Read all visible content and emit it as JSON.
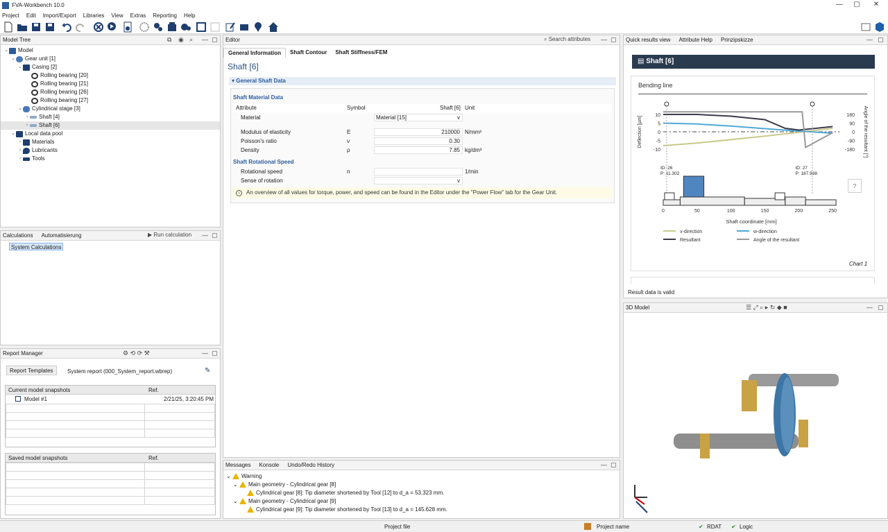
{
  "window": {
    "title": "FVA-Workbench 10.0"
  },
  "menu": [
    "Project",
    "Edit",
    "Import/Export",
    "Libraries",
    "View",
    "Extras",
    "Reporting",
    "Help"
  ],
  "model_tree": {
    "title": "Model Tree",
    "items": [
      {
        "label": "Model",
        "icon": "model-icon"
      },
      {
        "label": "Gear unit [1]",
        "icon": "gear-unit-icon"
      },
      {
        "label": "Casing [2]",
        "icon": "casing-icon"
      },
      {
        "label": "Rolling bearing [20]",
        "icon": "bearing-icon"
      },
      {
        "label": "Rolling bearing [21]",
        "icon": "bearing-icon"
      },
      {
        "label": "Rolling bearing [26]",
        "icon": "bearing-icon"
      },
      {
        "label": "Rolling bearing [27]",
        "icon": "bearing-icon"
      },
      {
        "label": "Cylindrical stage [3]",
        "icon": "stage-icon"
      },
      {
        "label": "Shaft [4]",
        "icon": "shaft-icon"
      },
      {
        "label": "Shaft [6]",
        "icon": "shaft-icon"
      },
      {
        "label": "Local data pool",
        "icon": "data-pool-icon"
      },
      {
        "label": "Materials",
        "icon": "materials-icon"
      },
      {
        "label": "Lubricants",
        "icon": "lubricant-icon"
      },
      {
        "label": "Tools",
        "icon": "tools-icon"
      }
    ]
  },
  "calculations": {
    "tab1": "Calculations",
    "tab2": "Automatisierung",
    "run": "Run calculation",
    "item": "System Calculations"
  },
  "report_manager": {
    "title": "Report Manager",
    "templates_label": "Report Templates",
    "report_name": "System report (000_System_report.wbrep)",
    "current_header": "Current model snapshots",
    "ref_header": "Ref.",
    "snapshot_name": "Model #1",
    "snapshot_date": "2/21/25, 3:20:45 PM",
    "saved_header": "Saved model snapshots",
    "saved_ref_header": "Ref."
  },
  "editor": {
    "tab": "Editor",
    "search": "Search attributes",
    "subtabs": [
      "General Information",
      "Shaft Contour",
      "Shaft Stiffness/FEM"
    ],
    "title": "Shaft [6]",
    "section": "General Shaft Data",
    "group1": "Shaft Material Data",
    "col_attribute": "Attribute",
    "col_symbol": "Symbol",
    "col_value": "Shaft [6]",
    "col_unit": "Unit",
    "rows": [
      {
        "attr": "Material",
        "sym": "",
        "val": "Material [15]",
        "unit": ""
      },
      {
        "attr": "Modulus of elasticity",
        "sym": "E",
        "val": "210000",
        "unit": "N/mm²"
      },
      {
        "attr": "Poisson's ratio",
        "sym": "ν",
        "val": "0.30",
        "unit": ""
      },
      {
        "attr": "Density",
        "sym": "ρ",
        "val": "7.85",
        "unit": "kg/dm³"
      }
    ],
    "group2": "Shaft Rotational Speed",
    "rows2": [
      {
        "attr": "Rotational speed",
        "sym": "n",
        "val": "",
        "unit": "1/min"
      },
      {
        "attr": "Sense of rotation",
        "sym": "",
        "val": "",
        "unit": ""
      }
    ],
    "info": "An overview of all values for torque, power, and speed can be found in the Editor under the \"Power Flow\" tab for the Gear Unit."
  },
  "messages": {
    "tabs": [
      "Messages",
      "Konsole",
      "Undo/Redo History"
    ],
    "warning": "Warning",
    "items": [
      {
        "title": "Main geometry - Cylindrical gear [8]",
        "detail": "Cylindrical gear [8]: Tip diameter shortened by Tool [12] to d_a = 53.323 mm."
      },
      {
        "title": "Main geometry - Cylindrical gear [9]",
        "detail": "Cylindrical gear [9]: Tip diameter shortened by Tool [13] to d_a = 145.628 mm."
      }
    ]
  },
  "quick_results": {
    "tabs": [
      "Quick results view",
      "Attribute Help",
      "Prinzipskizze"
    ],
    "header": "Shaft [6]",
    "card_title": "Bending line",
    "chart_label": "Chart 1",
    "status": "Result data is valid",
    "help_btn": "?"
  },
  "chart_data": {
    "type": "line",
    "xlabel": "Shaft coordinate [mm]",
    "ylabel": "Deflection [µm]",
    "y2label": "Angle of the resultant [°]",
    "xticks": [
      "0",
      "50",
      "100",
      "150",
      "200",
      "250"
    ],
    "yticks": [
      "10",
      "5",
      "0",
      "-5",
      "-10"
    ],
    "y2ticks": [
      "180",
      "90",
      "0",
      "-90",
      "-180"
    ],
    "xlim": [
      0,
      260
    ],
    "ylim": [
      -12,
      12
    ],
    "series": [
      {
        "name": "v-direction",
        "color": "#c8c98a",
        "x": [
          0,
          50,
          100,
          150,
          200,
          250
        ],
        "y": [
          -8,
          -6.5,
          -4.5,
          -2.5,
          -0.3,
          2
        ]
      },
      {
        "name": "w-direction",
        "color": "#4fa8d8",
        "x": [
          0,
          50,
          100,
          150,
          200,
          250
        ],
        "y": [
          5,
          4.5,
          3.3,
          1.8,
          0.4,
          -0.8
        ]
      },
      {
        "name": "Resultant",
        "color": "#3a3a4a",
        "x": [
          0,
          50,
          100,
          150,
          180,
          200,
          250
        ],
        "y": [
          10,
          10,
          9,
          7,
          2,
          1,
          3
        ]
      },
      {
        "name": "Angle of the resultant",
        "color": "#9a9a9a",
        "x": [
          0,
          50,
          100,
          150,
          205,
          210,
          250
        ],
        "y": [
          11.5,
          11.5,
          11.5,
          11.5,
          11.5,
          -9,
          -0.5
        ]
      }
    ],
    "bearings": [
      {
        "id": "ID: 26",
        "p": "P: 11.302"
      },
      {
        "id": "ID: 27",
        "p": "P: 187.938"
      }
    ]
  },
  "model3d": {
    "tab": "3D Model"
  },
  "statusbar": {
    "project_file": "Project file",
    "project_name": "Project name",
    "rdat": "RDAT",
    "logic": "Logic"
  }
}
